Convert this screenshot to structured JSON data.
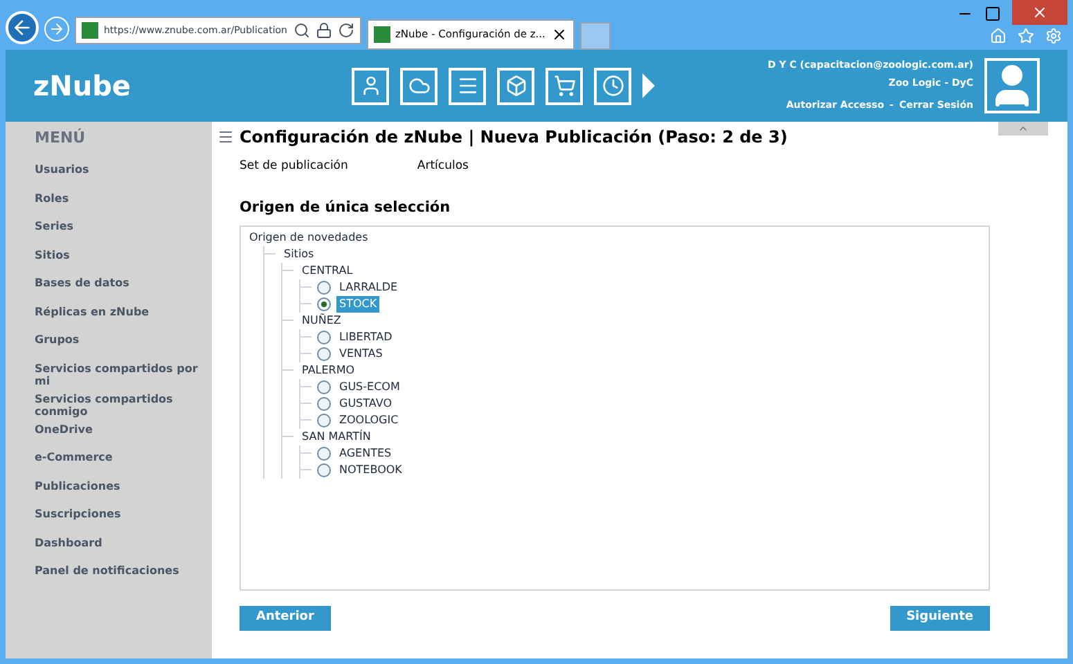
{
  "browser": {
    "url": "https://www.znube.com.ar/Publication",
    "tab_title": "zNube - Configuración de z..."
  },
  "header": {
    "logo": "zNube",
    "user": "D Y C (capacitacion@zoologic.com.ar)",
    "company": "Zoo Logic - DyC",
    "links": [
      "Autorizar Accesso",
      "Cerrar Sesión"
    ],
    "separator": "-"
  },
  "sidebar": {
    "title": "MENÚ",
    "items": [
      "Usuarios",
      "Roles",
      "Series",
      "Sitios",
      "Bases de datos",
      "Réplicas en zNube",
      "Grupos",
      "Servicios compartidos por mi",
      "Servicios compartidos conmigo",
      "OneDrive",
      "e-Commerce",
      "Publicaciones",
      "Suscripciones",
      "Dashboard",
      "Panel de notificaciones"
    ]
  },
  "page": {
    "title": "Configuración de zNube | Nueva Publicación (Paso: 2 de 3)",
    "steps": [
      "Set de publicación",
      "Artículos"
    ],
    "section_title": "Origen de única selección",
    "tree": {
      "label": "Origen de novedades",
      "children": [
        {
          "label": "Sitios",
          "children": [
            {
              "label": "CENTRAL",
              "children": [
                {
                  "label": "LARRALDE",
                  "kind": "radio",
                  "selected": false
                },
                {
                  "label": "STOCK",
                  "kind": "radio",
                  "selected": true
                }
              ]
            },
            {
              "label": "NUÑEZ",
              "children": [
                {
                  "label": "LIBERTAD",
                  "kind": "radio",
                  "selected": false
                },
                {
                  "label": "VENTAS",
                  "kind": "radio",
                  "selected": false
                }
              ]
            },
            {
              "label": "PALERMO",
              "children": [
                {
                  "label": "GUS-ECOM",
                  "kind": "radio",
                  "selected": false
                },
                {
                  "label": "GUSTAVO",
                  "kind": "radio",
                  "selected": false
                },
                {
                  "label": "ZOOLOGIC",
                  "kind": "radio",
                  "selected": false
                }
              ]
            },
            {
              "label": "SAN MARTÍN",
              "children": [
                {
                  "label": "AGENTES",
                  "kind": "radio",
                  "selected": false
                },
                {
                  "label": "NOTEBOOK",
                  "kind": "radio",
                  "selected": false
                }
              ]
            }
          ]
        }
      ]
    },
    "buttons": [
      "Anterior",
      "Siguiente"
    ]
  }
}
